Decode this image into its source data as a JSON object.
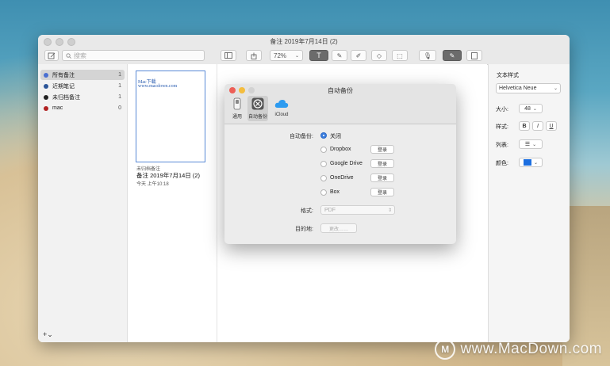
{
  "window": {
    "title": "备注 2019年7月14日 (2)",
    "search_placeholder": "搜索",
    "zoom": "72%"
  },
  "sidebar": {
    "items": [
      {
        "label": "所有备注",
        "count": "1",
        "color": "#4a6fd1"
      },
      {
        "label": "近期笔记",
        "count": "1",
        "color": "#2b5598"
      },
      {
        "label": "未归档备注",
        "count": "1",
        "color": "#222222"
      },
      {
        "label": "mac",
        "count": "0",
        "color": "#b12222"
      }
    ],
    "add_label": "+⌄"
  },
  "note": {
    "thumb_line1": "Mac下载",
    "thumb_line2": "www.macdown.com",
    "folder": "未归档备注",
    "title": "备注 2019年7月14日 (2)",
    "time": "今天 上午10:18"
  },
  "inspector": {
    "heading": "文本样式",
    "font": "Helvetica Neue",
    "size_label": "大小:",
    "size_value": "48",
    "style_label": "样式:",
    "list_label": "列表:",
    "color_label": "颜色:",
    "bold": "B",
    "italic": "I",
    "underline": "U",
    "text_color": "#1d6fe0"
  },
  "dialog": {
    "title": "自动备份",
    "tabs": [
      "通用",
      "自动备份",
      "iCloud"
    ],
    "backup_label": "自动备份:",
    "options": [
      "关闭",
      "Dropbox",
      "Google Drive",
      "OneDrive",
      "Box"
    ],
    "login_label": "登录",
    "format_label": "格式:",
    "format_value": "PDF",
    "dest_label": "目的地:",
    "dest_button": "更改……"
  },
  "watermark": "www.MacDown.com"
}
